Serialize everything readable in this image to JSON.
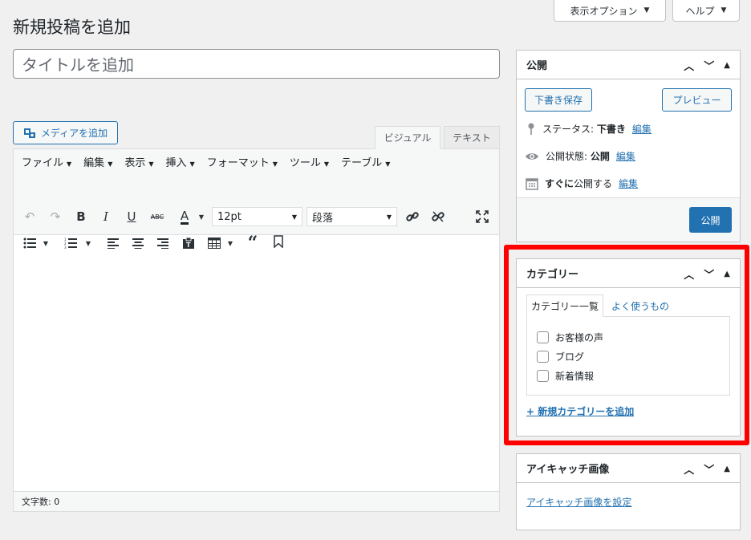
{
  "header": {
    "screen_options": "表示オプション",
    "help": "ヘルプ",
    "page_title": "新規投稿を追加"
  },
  "editor": {
    "title_placeholder": "タイトルを追加",
    "media_button": "メディアを追加",
    "tab_visual": "ビジュアル",
    "tab_text": "テキスト",
    "menu": [
      "ファイル",
      "編集",
      "表示",
      "挿入",
      "フォーマット",
      "ツール",
      "テーブル"
    ],
    "font_size": "12pt",
    "format": "段落",
    "word_count": "文字数: 0"
  },
  "publish": {
    "title": "公開",
    "save_draft": "下書き保存",
    "preview": "プレビュー",
    "status_label": "ステータス: ",
    "status_value": "下書き",
    "visibility_label": "公開状態: ",
    "visibility_value": "公開",
    "schedule_bold": "すぐに",
    "schedule_text": "公開する",
    "edit_link": "編集",
    "publish_button": "公開"
  },
  "category": {
    "title": "カテゴリー",
    "tab_all": "カテゴリー一覧",
    "tab_popular": "よく使うもの",
    "items": [
      "お客様の声",
      "ブログ",
      "新着情報"
    ],
    "add_new": "+ 新規カテゴリーを追加"
  },
  "featured": {
    "title": "アイキャッチ画像",
    "set_link": "アイキャッチ画像を設定"
  },
  "colors": {
    "accent": "#2271b1",
    "highlight": "#ff0000"
  }
}
